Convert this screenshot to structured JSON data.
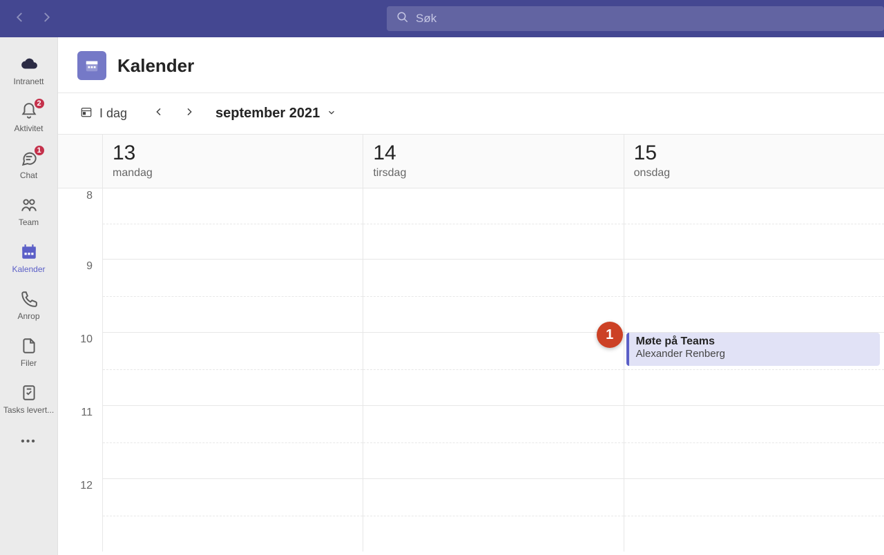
{
  "titlebar": {
    "search_placeholder": "Søk"
  },
  "rail": {
    "items": [
      {
        "label": "Intranett",
        "icon": "cloud",
        "badge": null,
        "active": false
      },
      {
        "label": "Aktivitet",
        "icon": "bell",
        "badge": "2",
        "active": false
      },
      {
        "label": "Chat",
        "icon": "chat",
        "badge": "1",
        "active": false
      },
      {
        "label": "Team",
        "icon": "team",
        "badge": null,
        "active": false
      },
      {
        "label": "Kalender",
        "icon": "calendar",
        "badge": null,
        "active": true
      },
      {
        "label": "Anrop",
        "icon": "phone",
        "badge": null,
        "active": false
      },
      {
        "label": "Filer",
        "icon": "file",
        "badge": null,
        "active": false
      },
      {
        "label": "Tasks levert...",
        "icon": "tasks",
        "badge": null,
        "active": false
      }
    ]
  },
  "header": {
    "title": "Kalender"
  },
  "toolbar": {
    "today_label": "I dag",
    "month_label": "september 2021"
  },
  "calendar": {
    "days": [
      {
        "num": "13",
        "name": "mandag"
      },
      {
        "num": "14",
        "name": "tirsdag"
      },
      {
        "num": "15",
        "name": "onsdag"
      }
    ],
    "hours": [
      "8",
      "9",
      "10",
      "11",
      "12"
    ],
    "event": {
      "title": "Møte på Teams",
      "organizer": "Alexander Renberg",
      "day_index": 2,
      "hour_index": 2
    }
  },
  "annotation": {
    "number": "1"
  }
}
